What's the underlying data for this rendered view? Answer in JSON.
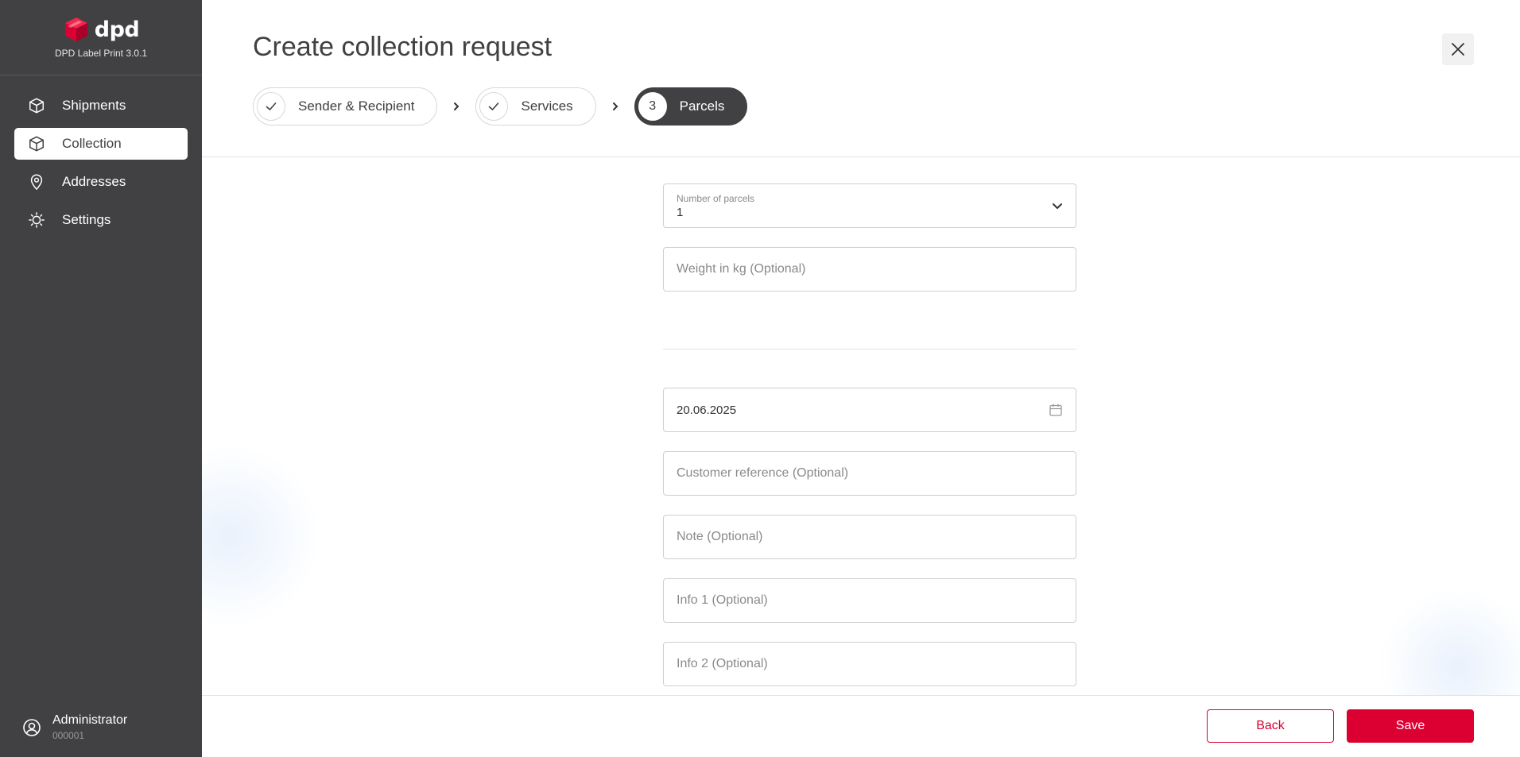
{
  "brand": {
    "name": "dpd",
    "version": "DPD Label Print 3.0.1",
    "color": "#dc0032"
  },
  "sidebar": {
    "items": [
      {
        "label": "Shipments",
        "icon": "box-icon",
        "active": false
      },
      {
        "label": "Collection",
        "icon": "box-icon",
        "active": true
      },
      {
        "label": "Addresses",
        "icon": "location-pin-icon",
        "active": false
      },
      {
        "label": "Settings",
        "icon": "gear-icon",
        "active": false
      }
    ]
  },
  "user": {
    "name": "Administrator",
    "id": "000001",
    "icon": "user-circle-icon"
  },
  "page": {
    "title": "Create collection request"
  },
  "stepper": {
    "steps": [
      {
        "label": "Sender & Recipient",
        "status": "done",
        "marker": "✓"
      },
      {
        "label": "Services",
        "status": "done",
        "marker": "✓"
      },
      {
        "label": "Parcels",
        "status": "active",
        "marker": "3"
      }
    ]
  },
  "form": {
    "parcels": {
      "label": "Number of parcels",
      "value": "1"
    },
    "weight": {
      "placeholder": "Weight in kg (Optional)"
    },
    "date": {
      "value": "20.06.2025"
    },
    "customer_reference": {
      "placeholder": "Customer reference (Optional)"
    },
    "note": {
      "placeholder": "Note (Optional)"
    },
    "info1": {
      "placeholder": "Info 1 (Optional)"
    },
    "info2": {
      "placeholder": "Info 2 (Optional)"
    }
  },
  "footer": {
    "back_label": "Back",
    "save_label": "Save"
  },
  "colors": {
    "sidebar": "#414042",
    "accent": "#dc0032"
  }
}
